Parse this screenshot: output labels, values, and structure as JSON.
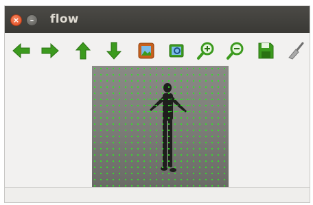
{
  "window": {
    "title": "flow",
    "close_glyph": "×",
    "minimize_glyph": "–"
  },
  "toolbar": {
    "buttons": [
      {
        "name": "back-arrow-icon",
        "color": "#3c9a1e"
      },
      {
        "name": "forward-arrow-icon",
        "color": "#3c9a1e"
      },
      {
        "name": "up-arrow-icon",
        "color": "#3c9a1e"
      },
      {
        "name": "down-arrow-icon",
        "color": "#3c9a1e"
      },
      {
        "name": "image-icon",
        "color": "#c8601c"
      },
      {
        "name": "zoom-fit-icon",
        "color": "#2a7fbf"
      },
      {
        "name": "zoom-in-icon",
        "color": "#3c9a1e"
      },
      {
        "name": "zoom-out-icon",
        "color": "#3c9a1e"
      },
      {
        "name": "save-icon",
        "color": "#3c9a1e"
      },
      {
        "name": "clear-brush-icon",
        "color": "#8a8a8a"
      }
    ]
  },
  "image": {
    "description_type": "optical-flow-overlay",
    "flow_color": "#35e02a"
  },
  "status": {
    "text": ""
  }
}
